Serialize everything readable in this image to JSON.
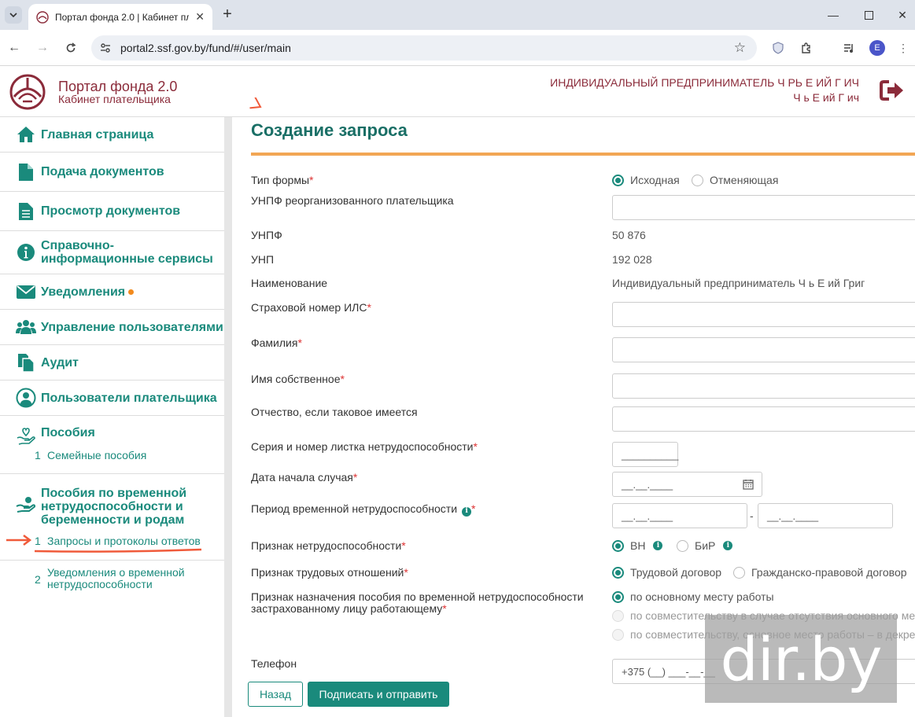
{
  "browser": {
    "tab_title": "Портал фонда 2.0 | Кабинет пл",
    "url": "portal2.ssf.gov.by/fund/#/user/main",
    "profile_initial": "E"
  },
  "header": {
    "title": "Портал фонда 2.0",
    "subtitle": "Кабинет плательщика",
    "user_org": "ИНДИВИДУАЛЬНЫЙ ПРЕДПРИНИМАТЕЛЬ Ч    РЬ Е     ИЙ Г         ИЧ",
    "user_name": "Ч    ь Е      ий Г             ич"
  },
  "sidebar": {
    "items": [
      {
        "label": "Главная страница",
        "icon": "home-icon"
      },
      {
        "label": "Подача документов",
        "icon": "file-icon"
      },
      {
        "label": "Просмотр документов",
        "icon": "document-list-icon"
      },
      {
        "label": "Справочно-информационные сервисы",
        "icon": "info-icon"
      },
      {
        "label": "Уведомления",
        "icon": "envelope-icon"
      },
      {
        "label": "Управление пользователями",
        "icon": "users-icon"
      },
      {
        "label": "Аудит",
        "icon": "copy-icon"
      },
      {
        "label": "Пользователи плательщика",
        "icon": "user-circle-icon"
      },
      {
        "label": "Пособия",
        "icon": "hand-heart-icon"
      },
      {
        "label": "Пособия по временной нетрудоспособности и беременности и родам",
        "icon": "hand-money-icon"
      }
    ],
    "benefits_sub": [
      {
        "num": "1",
        "label": "Семейные пособия"
      }
    ],
    "temp_sub": [
      {
        "num": "1",
        "label": "Запросы и протоколы ответов"
      },
      {
        "num": "2",
        "label": "Уведомления о временной нетрудоспособности"
      }
    ]
  },
  "form": {
    "title": "Создание запроса",
    "form_type": {
      "label": "Тип формы",
      "options": [
        "Исходная",
        "Отменяющая"
      ]
    },
    "reorg_unpf": {
      "label": "УНПФ реорганизованного плательщика"
    },
    "unpf": {
      "label": "УНПФ",
      "value": "50      876"
    },
    "unp": {
      "label": "УНП",
      "value": "192      028"
    },
    "name": {
      "label": "Наименование",
      "value": "Индивидуальный предприниматель Ч      ь Е        ий Григ"
    },
    "ils": {
      "label": "Страховой номер ИЛС"
    },
    "surname": {
      "label": "Фамилия"
    },
    "first_name": {
      "label": "Имя собственное"
    },
    "patronymic": {
      "label": "Отчество, если таковое имеется"
    },
    "sheet": {
      "label": "Серия и номер листка нетрудоспособности",
      "placeholder": "__________"
    },
    "case_start": {
      "label": "Дата начала случая",
      "placeholder": "__.__.____"
    },
    "period": {
      "label": "Период временной нетрудоспособности",
      "from": "__.__.____",
      "dash": "-",
      "to": "__.__.____"
    },
    "disability_sign": {
      "label": "Признак нетрудоспособности",
      "options": [
        "ВН",
        "БиР"
      ]
    },
    "labor_sign": {
      "label": "Признак трудовых отношений",
      "options": [
        "Трудовой договор",
        "Гражданско-правовой договор"
      ]
    },
    "assign_sign": {
      "label_1": "Признак назначения пособия по временной нетрудоспособности",
      "label_2": "застрахованному лицу работающему",
      "options": [
        "по основному месту работы",
        "по совместительству в случае отсутствия основного мес",
        "по совместительству, основное место работы – в декрет"
      ]
    },
    "phone": {
      "label": "Телефон",
      "placeholder": "+375 (__) ___-__-__"
    }
  },
  "buttons": {
    "back": "Назад",
    "submit": "Подписать и отправить"
  },
  "watermark": "dir.by",
  "colors": {
    "teal": "#1a8a7c",
    "brand": "#8b2b3a",
    "accent": "#f2a654"
  }
}
